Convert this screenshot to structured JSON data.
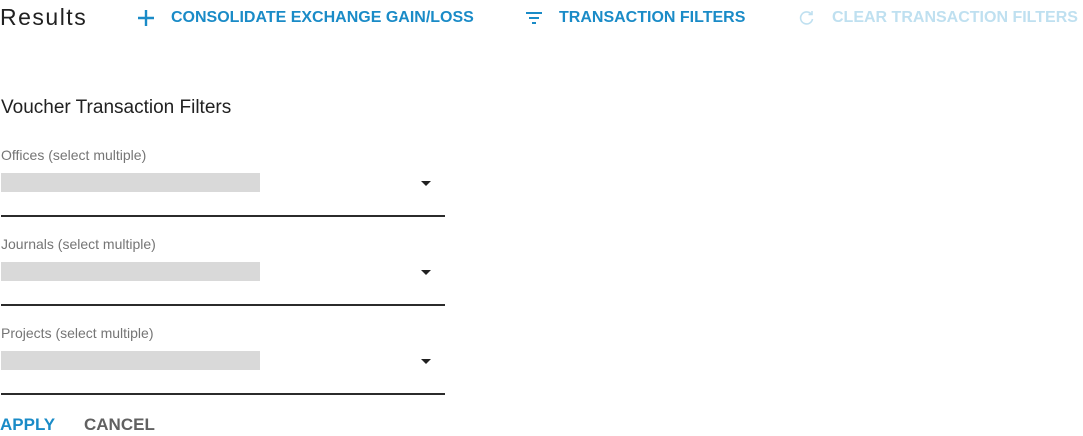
{
  "header": {
    "title": "Results",
    "consolidate_label": "CONSOLIDATE EXCHANGE GAIN/LOSS",
    "transaction_filters_label": "TRANSACTION FILTERS",
    "clear_filters_label": "CLEAR TRANSACTION FILTERS"
  },
  "panel": {
    "title": "Voucher Transaction Filters",
    "fields": [
      {
        "label": "Offices (select multiple)"
      },
      {
        "label": "Journals (select multiple)"
      },
      {
        "label": "Projects (select multiple)"
      }
    ]
  },
  "actions": {
    "apply_label": "APPLY",
    "cancel_label": "CANCEL"
  },
  "colors": {
    "accent": "#1a8bc7",
    "disabled": "#bfe0f0",
    "placeholder_fill": "#d9d9d9"
  },
  "icons": {
    "consolidate": "plus-icon",
    "transaction_filters": "filter-list-icon",
    "clear_filters": "refresh-icon",
    "dropdown": "caret-down-icon"
  }
}
